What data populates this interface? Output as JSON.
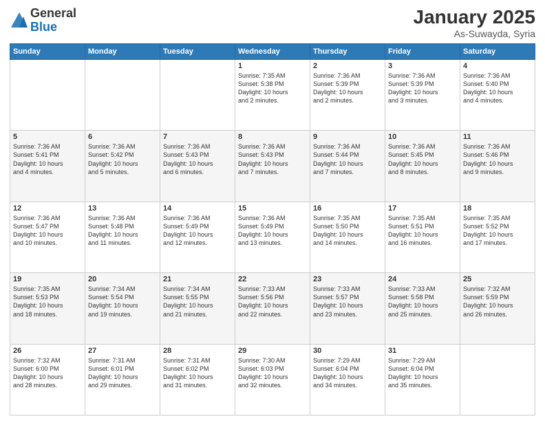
{
  "header": {
    "logo_general": "General",
    "logo_blue": "Blue",
    "title": "January 2025",
    "location": "As-Suwayda, Syria"
  },
  "weekdays": [
    "Sunday",
    "Monday",
    "Tuesday",
    "Wednesday",
    "Thursday",
    "Friday",
    "Saturday"
  ],
  "rows": [
    {
      "row_class": "",
      "cells": [
        {
          "day": "",
          "lines": []
        },
        {
          "day": "",
          "lines": []
        },
        {
          "day": "",
          "lines": []
        },
        {
          "day": "1",
          "lines": [
            "Sunrise: 7:35 AM",
            "Sunset: 5:38 PM",
            "Daylight: 10 hours",
            "and 2 minutes."
          ]
        },
        {
          "day": "2",
          "lines": [
            "Sunrise: 7:36 AM",
            "Sunset: 5:39 PM",
            "Daylight: 10 hours",
            "and 2 minutes."
          ]
        },
        {
          "day": "3",
          "lines": [
            "Sunrise: 7:36 AM",
            "Sunset: 5:39 PM",
            "Daylight: 10 hours",
            "and 3 minutes."
          ]
        },
        {
          "day": "4",
          "lines": [
            "Sunrise: 7:36 AM",
            "Sunset: 5:40 PM",
            "Daylight: 10 hours",
            "and 4 minutes."
          ]
        }
      ]
    },
    {
      "row_class": "alt",
      "cells": [
        {
          "day": "5",
          "lines": [
            "Sunrise: 7:36 AM",
            "Sunset: 5:41 PM",
            "Daylight: 10 hours",
            "and 4 minutes."
          ]
        },
        {
          "day": "6",
          "lines": [
            "Sunrise: 7:36 AM",
            "Sunset: 5:42 PM",
            "Daylight: 10 hours",
            "and 5 minutes."
          ]
        },
        {
          "day": "7",
          "lines": [
            "Sunrise: 7:36 AM",
            "Sunset: 5:43 PM",
            "Daylight: 10 hours",
            "and 6 minutes."
          ]
        },
        {
          "day": "8",
          "lines": [
            "Sunrise: 7:36 AM",
            "Sunset: 5:43 PM",
            "Daylight: 10 hours",
            "and 7 minutes."
          ]
        },
        {
          "day": "9",
          "lines": [
            "Sunrise: 7:36 AM",
            "Sunset: 5:44 PM",
            "Daylight: 10 hours",
            "and 7 minutes."
          ]
        },
        {
          "day": "10",
          "lines": [
            "Sunrise: 7:36 AM",
            "Sunset: 5:45 PM",
            "Daylight: 10 hours",
            "and 8 minutes."
          ]
        },
        {
          "day": "11",
          "lines": [
            "Sunrise: 7:36 AM",
            "Sunset: 5:46 PM",
            "Daylight: 10 hours",
            "and 9 minutes."
          ]
        }
      ]
    },
    {
      "row_class": "",
      "cells": [
        {
          "day": "12",
          "lines": [
            "Sunrise: 7:36 AM",
            "Sunset: 5:47 PM",
            "Daylight: 10 hours",
            "and 10 minutes."
          ]
        },
        {
          "day": "13",
          "lines": [
            "Sunrise: 7:36 AM",
            "Sunset: 5:48 PM",
            "Daylight: 10 hours",
            "and 11 minutes."
          ]
        },
        {
          "day": "14",
          "lines": [
            "Sunrise: 7:36 AM",
            "Sunset: 5:49 PM",
            "Daylight: 10 hours",
            "and 12 minutes."
          ]
        },
        {
          "day": "15",
          "lines": [
            "Sunrise: 7:36 AM",
            "Sunset: 5:49 PM",
            "Daylight: 10 hours",
            "and 13 minutes."
          ]
        },
        {
          "day": "16",
          "lines": [
            "Sunrise: 7:35 AM",
            "Sunset: 5:50 PM",
            "Daylight: 10 hours",
            "and 14 minutes."
          ]
        },
        {
          "day": "17",
          "lines": [
            "Sunrise: 7:35 AM",
            "Sunset: 5:51 PM",
            "Daylight: 10 hours",
            "and 16 minutes."
          ]
        },
        {
          "day": "18",
          "lines": [
            "Sunrise: 7:35 AM",
            "Sunset: 5:52 PM",
            "Daylight: 10 hours",
            "and 17 minutes."
          ]
        }
      ]
    },
    {
      "row_class": "alt",
      "cells": [
        {
          "day": "19",
          "lines": [
            "Sunrise: 7:35 AM",
            "Sunset: 5:53 PM",
            "Daylight: 10 hours",
            "and 18 minutes."
          ]
        },
        {
          "day": "20",
          "lines": [
            "Sunrise: 7:34 AM",
            "Sunset: 5:54 PM",
            "Daylight: 10 hours",
            "and 19 minutes."
          ]
        },
        {
          "day": "21",
          "lines": [
            "Sunrise: 7:34 AM",
            "Sunset: 5:55 PM",
            "Daylight: 10 hours",
            "and 21 minutes."
          ]
        },
        {
          "day": "22",
          "lines": [
            "Sunrise: 7:33 AM",
            "Sunset: 5:56 PM",
            "Daylight: 10 hours",
            "and 22 minutes."
          ]
        },
        {
          "day": "23",
          "lines": [
            "Sunrise: 7:33 AM",
            "Sunset: 5:57 PM",
            "Daylight: 10 hours",
            "and 23 minutes."
          ]
        },
        {
          "day": "24",
          "lines": [
            "Sunrise: 7:33 AM",
            "Sunset: 5:58 PM",
            "Daylight: 10 hours",
            "and 25 minutes."
          ]
        },
        {
          "day": "25",
          "lines": [
            "Sunrise: 7:32 AM",
            "Sunset: 5:59 PM",
            "Daylight: 10 hours",
            "and 26 minutes."
          ]
        }
      ]
    },
    {
      "row_class": "",
      "cells": [
        {
          "day": "26",
          "lines": [
            "Sunrise: 7:32 AM",
            "Sunset: 6:00 PM",
            "Daylight: 10 hours",
            "and 28 minutes."
          ]
        },
        {
          "day": "27",
          "lines": [
            "Sunrise: 7:31 AM",
            "Sunset: 6:01 PM",
            "Daylight: 10 hours",
            "and 29 minutes."
          ]
        },
        {
          "day": "28",
          "lines": [
            "Sunrise: 7:31 AM",
            "Sunset: 6:02 PM",
            "Daylight: 10 hours",
            "and 31 minutes."
          ]
        },
        {
          "day": "29",
          "lines": [
            "Sunrise: 7:30 AM",
            "Sunset: 6:03 PM",
            "Daylight: 10 hours",
            "and 32 minutes."
          ]
        },
        {
          "day": "30",
          "lines": [
            "Sunrise: 7:29 AM",
            "Sunset: 6:04 PM",
            "Daylight: 10 hours",
            "and 34 minutes."
          ]
        },
        {
          "day": "31",
          "lines": [
            "Sunrise: 7:29 AM",
            "Sunset: 6:04 PM",
            "Daylight: 10 hours",
            "and 35 minutes."
          ]
        },
        {
          "day": "",
          "lines": []
        }
      ]
    }
  ]
}
